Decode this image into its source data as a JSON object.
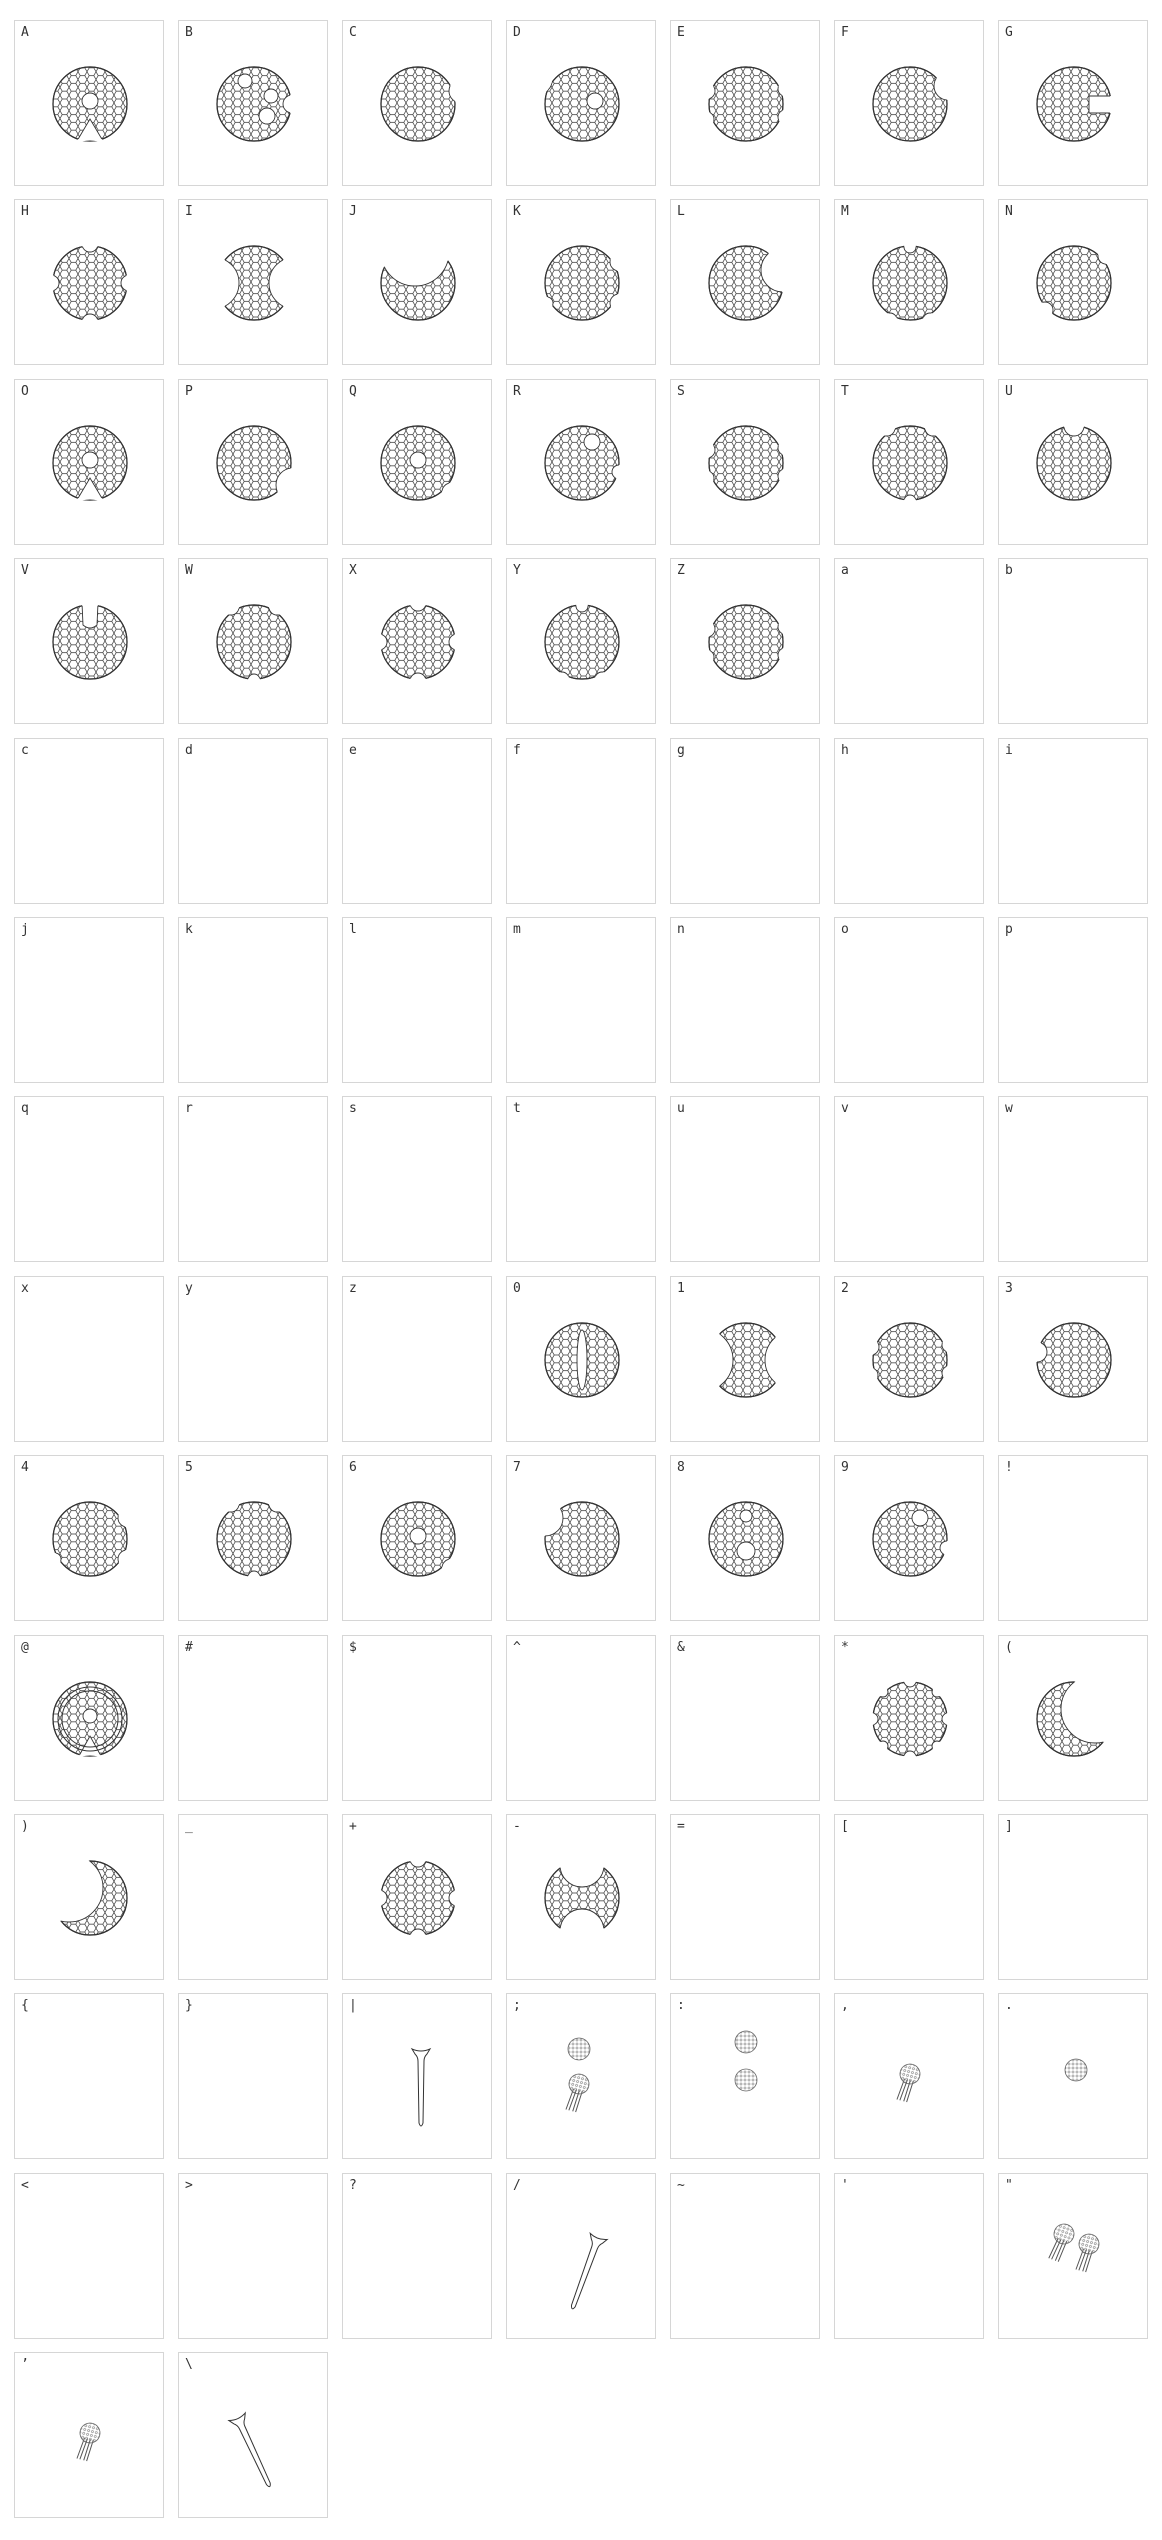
{
  "title": "",
  "pattern_color": "#333333",
  "cells": [
    {
      "char": "A",
      "glyph": "ball-hole-center"
    },
    {
      "char": "B",
      "glyph": "ball-three-holes"
    },
    {
      "char": "C",
      "glyph": "ball-notch-right"
    },
    {
      "char": "D",
      "glyph": "ball-notch-left-hole"
    },
    {
      "char": "E",
      "glyph": "ball-notches-side"
    },
    {
      "char": "F",
      "glyph": "ball-bite-right-top"
    },
    {
      "char": "G",
      "glyph": "ball-g-notch"
    },
    {
      "char": "H",
      "glyph": "ball-notches-four"
    },
    {
      "char": "I",
      "glyph": "hourglass"
    },
    {
      "char": "J",
      "glyph": "crescent-up"
    },
    {
      "char": "K",
      "glyph": "ball-notches-right"
    },
    {
      "char": "L",
      "glyph": "crescent-bite"
    },
    {
      "char": "M",
      "glyph": "ball-notches-bottom"
    },
    {
      "char": "N",
      "glyph": "ball-notches-diag"
    },
    {
      "char": "O",
      "glyph": "ball-hole-center"
    },
    {
      "char": "P",
      "glyph": "ball-bite-low-right"
    },
    {
      "char": "Q",
      "glyph": "ball-hole-bite"
    },
    {
      "char": "R",
      "glyph": "ball-hole-notch"
    },
    {
      "char": "S",
      "glyph": "ball-notches-side"
    },
    {
      "char": "T",
      "glyph": "ball-notches-top"
    },
    {
      "char": "U",
      "glyph": "ball-notch-top"
    },
    {
      "char": "V",
      "glyph": "ball-notch-top-deep"
    },
    {
      "char": "W",
      "glyph": "ball-notches-top"
    },
    {
      "char": "X",
      "glyph": "ball-notches-four"
    },
    {
      "char": "Y",
      "glyph": "ball-notches-bottom"
    },
    {
      "char": "Z",
      "glyph": "ball-notches-side"
    },
    {
      "char": "a",
      "glyph": ""
    },
    {
      "char": "b",
      "glyph": ""
    },
    {
      "char": "c",
      "glyph": ""
    },
    {
      "char": "d",
      "glyph": ""
    },
    {
      "char": "e",
      "glyph": ""
    },
    {
      "char": "f",
      "glyph": ""
    },
    {
      "char": "g",
      "glyph": ""
    },
    {
      "char": "h",
      "glyph": ""
    },
    {
      "char": "i",
      "glyph": ""
    },
    {
      "char": "j",
      "glyph": ""
    },
    {
      "char": "k",
      "glyph": ""
    },
    {
      "char": "l",
      "glyph": ""
    },
    {
      "char": "m",
      "glyph": ""
    },
    {
      "char": "n",
      "glyph": ""
    },
    {
      "char": "o",
      "glyph": ""
    },
    {
      "char": "p",
      "glyph": ""
    },
    {
      "char": "q",
      "glyph": ""
    },
    {
      "char": "r",
      "glyph": ""
    },
    {
      "char": "s",
      "glyph": ""
    },
    {
      "char": "t",
      "glyph": ""
    },
    {
      "char": "u",
      "glyph": ""
    },
    {
      "char": "v",
      "glyph": ""
    },
    {
      "char": "w",
      "glyph": ""
    },
    {
      "char": "x",
      "glyph": ""
    },
    {
      "char": "y",
      "glyph": ""
    },
    {
      "char": "z",
      "glyph": ""
    },
    {
      "char": "0",
      "glyph": "ball-slot-vertical"
    },
    {
      "char": "1",
      "glyph": "hourglass-thin"
    },
    {
      "char": "2",
      "glyph": "ball-notches-side"
    },
    {
      "char": "3",
      "glyph": "ball-notch-left"
    },
    {
      "char": "4",
      "glyph": "ball-notches-right"
    },
    {
      "char": "5",
      "glyph": "ball-notches-top"
    },
    {
      "char": "6",
      "glyph": "ball-hole-bite"
    },
    {
      "char": "7",
      "glyph": "ball-bite-left"
    },
    {
      "char": "8",
      "glyph": "ball-two-holes"
    },
    {
      "char": "9",
      "glyph": "ball-hole-notch"
    },
    {
      "char": "!",
      "glyph": ""
    },
    {
      "char": "@",
      "glyph": "ball-ringed"
    },
    {
      "char": "#",
      "glyph": ""
    },
    {
      "char": "$",
      "glyph": ""
    },
    {
      "char": "^",
      "glyph": ""
    },
    {
      "char": "&",
      "glyph": ""
    },
    {
      "char": "*",
      "glyph": "ball-notches-many"
    },
    {
      "char": "(",
      "glyph": "crescent-left"
    },
    {
      "char": ")",
      "glyph": "crescent-right"
    },
    {
      "char": "_",
      "glyph": ""
    },
    {
      "char": "+",
      "glyph": "ball-notches-four"
    },
    {
      "char": "-",
      "glyph": "bowtie"
    },
    {
      "char": "=",
      "glyph": ""
    },
    {
      "char": "[",
      "glyph": ""
    },
    {
      "char": "]",
      "glyph": ""
    },
    {
      "char": "{",
      "glyph": ""
    },
    {
      "char": "}",
      "glyph": ""
    },
    {
      "char": "|",
      "glyph": "tee-vertical"
    },
    {
      "char": ";",
      "glyph": "ball-and-marker"
    },
    {
      "char": ":",
      "glyph": "two-small-balls"
    },
    {
      "char": ",",
      "glyph": "ball-marker"
    },
    {
      "char": ".",
      "glyph": "small-ball"
    },
    {
      "char": "<",
      "glyph": ""
    },
    {
      "char": ">",
      "glyph": ""
    },
    {
      "char": "?",
      "glyph": ""
    },
    {
      "char": "/",
      "glyph": "tee-slanted"
    },
    {
      "char": "~",
      "glyph": ""
    },
    {
      "char": "'",
      "glyph": ""
    },
    {
      "char": "\"",
      "glyph": "two-markers"
    },
    {
      "char": "’",
      "glyph": "ball-marker"
    },
    {
      "char": "\\",
      "glyph": "tee-slanted-back"
    }
  ]
}
